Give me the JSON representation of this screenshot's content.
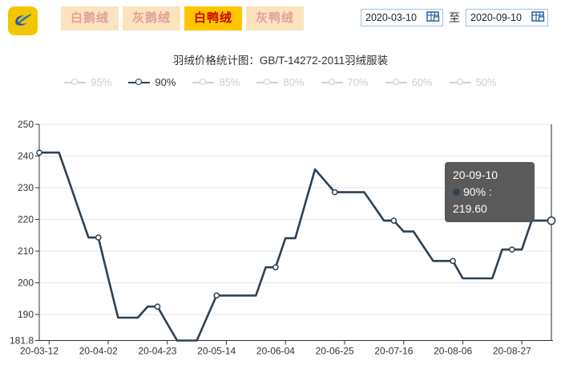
{
  "header": {
    "tabs": [
      {
        "label": "白鹅绒",
        "active": false
      },
      {
        "label": "灰鹅绒",
        "active": false
      },
      {
        "label": "白鸭绒",
        "active": true
      },
      {
        "label": "灰鸭绒",
        "active": false
      }
    ],
    "date_from": "2020-03-10",
    "date_separator": "至",
    "date_to": "2020-09-10"
  },
  "title": "羽绒价格统计图：GB/T-14272-2011羽绒服装",
  "legend": {
    "items": [
      {
        "label": "95%",
        "active": false
      },
      {
        "label": "90%",
        "active": true
      },
      {
        "label": "85%",
        "active": false
      },
      {
        "label": "80%",
        "active": false
      },
      {
        "label": "70%",
        "active": false
      },
      {
        "label": "60%",
        "active": false
      },
      {
        "label": "50%",
        "active": false
      }
    ]
  },
  "tooltip": {
    "date": "20-09-10",
    "series": "90%",
    "value_text": "90% : 219.60"
  },
  "colors": {
    "accent_yellow": "#ffc600",
    "tab_active_text": "#cc0000",
    "tab_inactive_bg": "#fbe3bd",
    "line": "#2e4154",
    "legend_inactive": "#ced3d8",
    "tooltip_bg": "#4d4d4d"
  },
  "chart_data": {
    "type": "line",
    "title": "羽绒价格统计图：GB/T-14272-2011羽绒服装",
    "series_name": "90%",
    "x": [
      "20-03-12",
      "20-03-16",
      "20-03-19",
      "20-03-23",
      "20-03-26",
      "20-03-30",
      "20-04-02",
      "20-04-06",
      "20-04-09",
      "20-04-13",
      "20-04-16",
      "20-04-20",
      "20-04-23",
      "20-04-27",
      "20-04-30",
      "20-05-04",
      "20-05-07",
      "20-05-11",
      "20-05-14",
      "20-05-18",
      "20-05-21",
      "20-05-25",
      "20-05-28",
      "20-06-01",
      "20-06-04",
      "20-06-08",
      "20-06-11",
      "20-06-15",
      "20-06-18",
      "20-06-22",
      "20-06-25",
      "20-06-29",
      "20-07-02",
      "20-07-06",
      "20-07-09",
      "20-07-13",
      "20-07-16",
      "20-07-20",
      "20-07-23",
      "20-07-27",
      "20-07-30",
      "20-08-03",
      "20-08-06",
      "20-08-10",
      "20-08-13",
      "20-08-17",
      "20-08-20",
      "20-08-24",
      "20-08-27",
      "20-08-31",
      "20-09-03",
      "20-09-07",
      "20-09-10"
    ],
    "values": [
      241.1,
      241.1,
      241.1,
      232.2,
      223.2,
      214.3,
      214.3,
      201.6,
      189,
      189,
      189,
      192.5,
      192.5,
      187.1,
      181.8,
      181.8,
      181.8,
      188.9,
      196,
      196,
      196,
      196,
      196,
      204.9,
      204.9,
      214.1,
      214.1,
      225,
      235.8,
      232.2,
      228.6,
      228.6,
      228.6,
      228.6,
      224.1,
      219.6,
      219.6,
      216.2,
      216.2,
      211.5,
      206.9,
      206.9,
      206.9,
      201.4,
      201.4,
      201.4,
      201.4,
      210.5,
      210.5,
      210.5,
      219.6,
      219.6,
      219.6
    ],
    "x_tick_labels": [
      "20-03-12",
      "20-04-02",
      "20-04-23",
      "20-05-14",
      "20-06-04",
      "20-06-25",
      "20-07-16",
      "20-08-06",
      "20-08-27"
    ],
    "label_every": 6,
    "marker_indices": [
      0,
      6,
      12,
      18,
      24,
      30,
      36,
      42,
      48
    ],
    "highlight_index": 52,
    "y_ticks": [
      181.8,
      190,
      200,
      210,
      220,
      230,
      240,
      250
    ],
    "ylim": [
      181.8,
      250
    ],
    "xlabel": "",
    "ylabel": "",
    "grid": true,
    "line_color": "#2e4154",
    "legend_position": "top"
  }
}
